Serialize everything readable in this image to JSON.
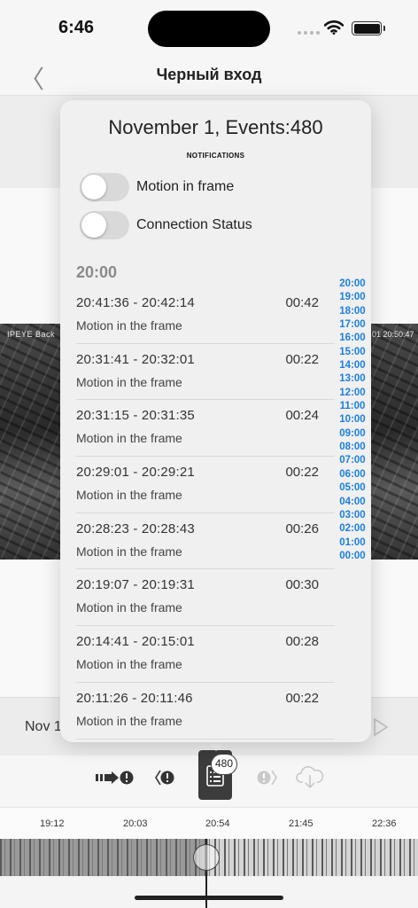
{
  "status_bar": {
    "time": "6:46"
  },
  "nav": {
    "back_icon": "chevron-left-icon",
    "title": "Черный вход"
  },
  "camera": {
    "overlay_left": "IPEYE Back",
    "overlay_right": "01 20:50:47"
  },
  "date_label": "Nov 1",
  "popover": {
    "title": "November 1, Events:480",
    "subtitle": "NOTIFICATIONS",
    "toggles": [
      {
        "label": "Motion in frame",
        "on": false
      },
      {
        "label": "Connection Status",
        "on": false
      }
    ],
    "hour_header": "20:00",
    "events": [
      {
        "range": "20:41:36 - 20:42:14",
        "duration": "00:42",
        "type": "Motion in the frame"
      },
      {
        "range": "20:31:41 - 20:32:01",
        "duration": "00:22",
        "type": "Motion in the frame"
      },
      {
        "range": "20:31:15 - 20:31:35",
        "duration": "00:24",
        "type": "Motion in the frame"
      },
      {
        "range": "20:29:01 - 20:29:21",
        "duration": "00:22",
        "type": "Motion in the frame"
      },
      {
        "range": "20:28:23 - 20:28:43",
        "duration": "00:26",
        "type": "Motion in the frame"
      },
      {
        "range": "20:19:07 - 20:19:31",
        "duration": "00:30",
        "type": "Motion in the frame"
      },
      {
        "range": "20:14:41 - 20:15:01",
        "duration": "00:28",
        "type": "Motion in the frame"
      },
      {
        "range": "20:11:26 - 20:11:46",
        "duration": "00:22",
        "type": "Motion in the frame"
      }
    ],
    "hour_index": [
      "20:00",
      "19:00",
      "18:00",
      "17:00",
      "16:00",
      "15:00",
      "14:00",
      "13:00",
      "12:00",
      "11:00",
      "10:00",
      "09:00",
      "08:00",
      "07:00",
      "06:00",
      "05:00",
      "04:00",
      "03:00",
      "02:00",
      "01:00",
      "00:00"
    ]
  },
  "toolbar": {
    "event_count": "480",
    "icons": [
      "next-event-arrow-icon",
      "prev-alert-icon",
      "event-list-icon",
      "next-alert-icon",
      "cloud-download-icon"
    ]
  },
  "timeline": {
    "ticks": [
      "19:12",
      "20:03",
      "20:54",
      "21:45",
      "22:36"
    ]
  },
  "colors": {
    "accent": "#1a7fe0",
    "popover_bg": "#f0f0f0"
  }
}
